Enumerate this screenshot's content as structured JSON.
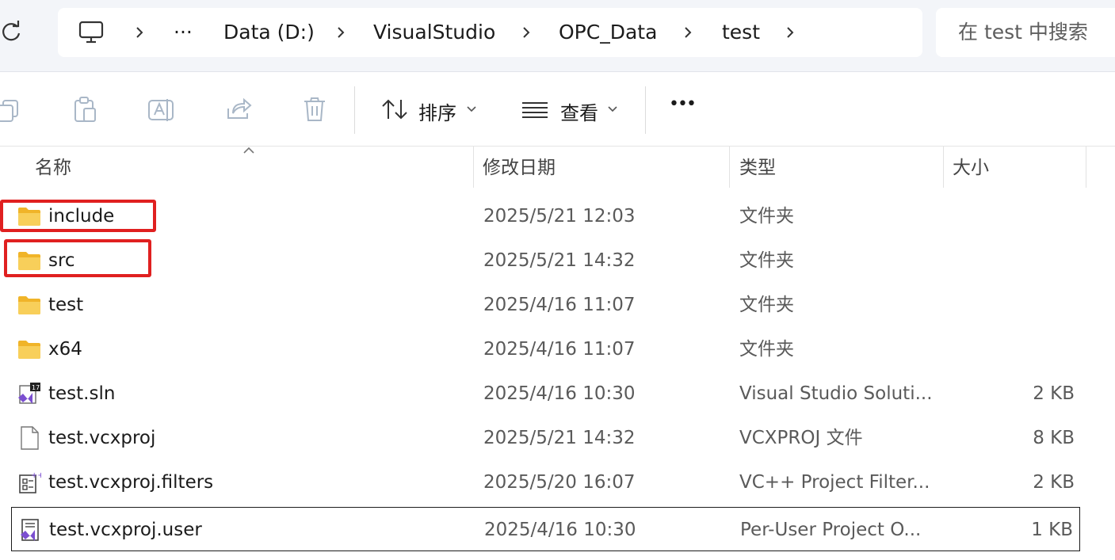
{
  "address_bar": {
    "overflow": "···",
    "crumbs": [
      "Data (D:)",
      "VisualStudio",
      "OPC_Data",
      "test"
    ]
  },
  "search": {
    "placeholder": "在 test 中搜索"
  },
  "toolbar": {
    "sort_label": "排序",
    "view_label": "查看",
    "more_label": "•••"
  },
  "columns": {
    "name": "名称",
    "modified": "修改日期",
    "type": "类型",
    "size": "大小"
  },
  "files": [
    {
      "name": "include",
      "modified": "2025/5/21 12:03",
      "type": "文件夹",
      "size": "",
      "icon": "folder-icon",
      "highlighted": true
    },
    {
      "name": "src",
      "modified": "2025/5/21 14:32",
      "type": "文件夹",
      "size": "",
      "icon": "folder-icon",
      "highlighted": true
    },
    {
      "name": "test",
      "modified": "2025/4/16 11:07",
      "type": "文件夹",
      "size": "",
      "icon": "folder-icon"
    },
    {
      "name": "x64",
      "modified": "2025/4/16 11:07",
      "type": "文件夹",
      "size": "",
      "icon": "folder-icon"
    },
    {
      "name": "test.sln",
      "modified": "2025/4/16 10:30",
      "type": "Visual Studio Soluti...",
      "size": "2 KB",
      "icon": "vs-solution-icon"
    },
    {
      "name": "test.vcxproj",
      "modified": "2025/5/21 14:32",
      "type": "VCXPROJ 文件",
      "size": "8 KB",
      "icon": "file-icon"
    },
    {
      "name": "test.vcxproj.filters",
      "modified": "2025/5/20 16:07",
      "type": "VC++ Project Filter...",
      "size": "2 KB",
      "icon": "filters-file-icon"
    },
    {
      "name": "test.vcxproj.user",
      "modified": "2025/4/16 10:30",
      "type": "Per-User Project O...",
      "size": "1 KB",
      "icon": "vs-user-file-icon",
      "focused": true
    }
  ],
  "colors": {
    "highlight": "#e02020",
    "folder": "#f8c94a",
    "vs_purple": "#6c3fc1"
  }
}
